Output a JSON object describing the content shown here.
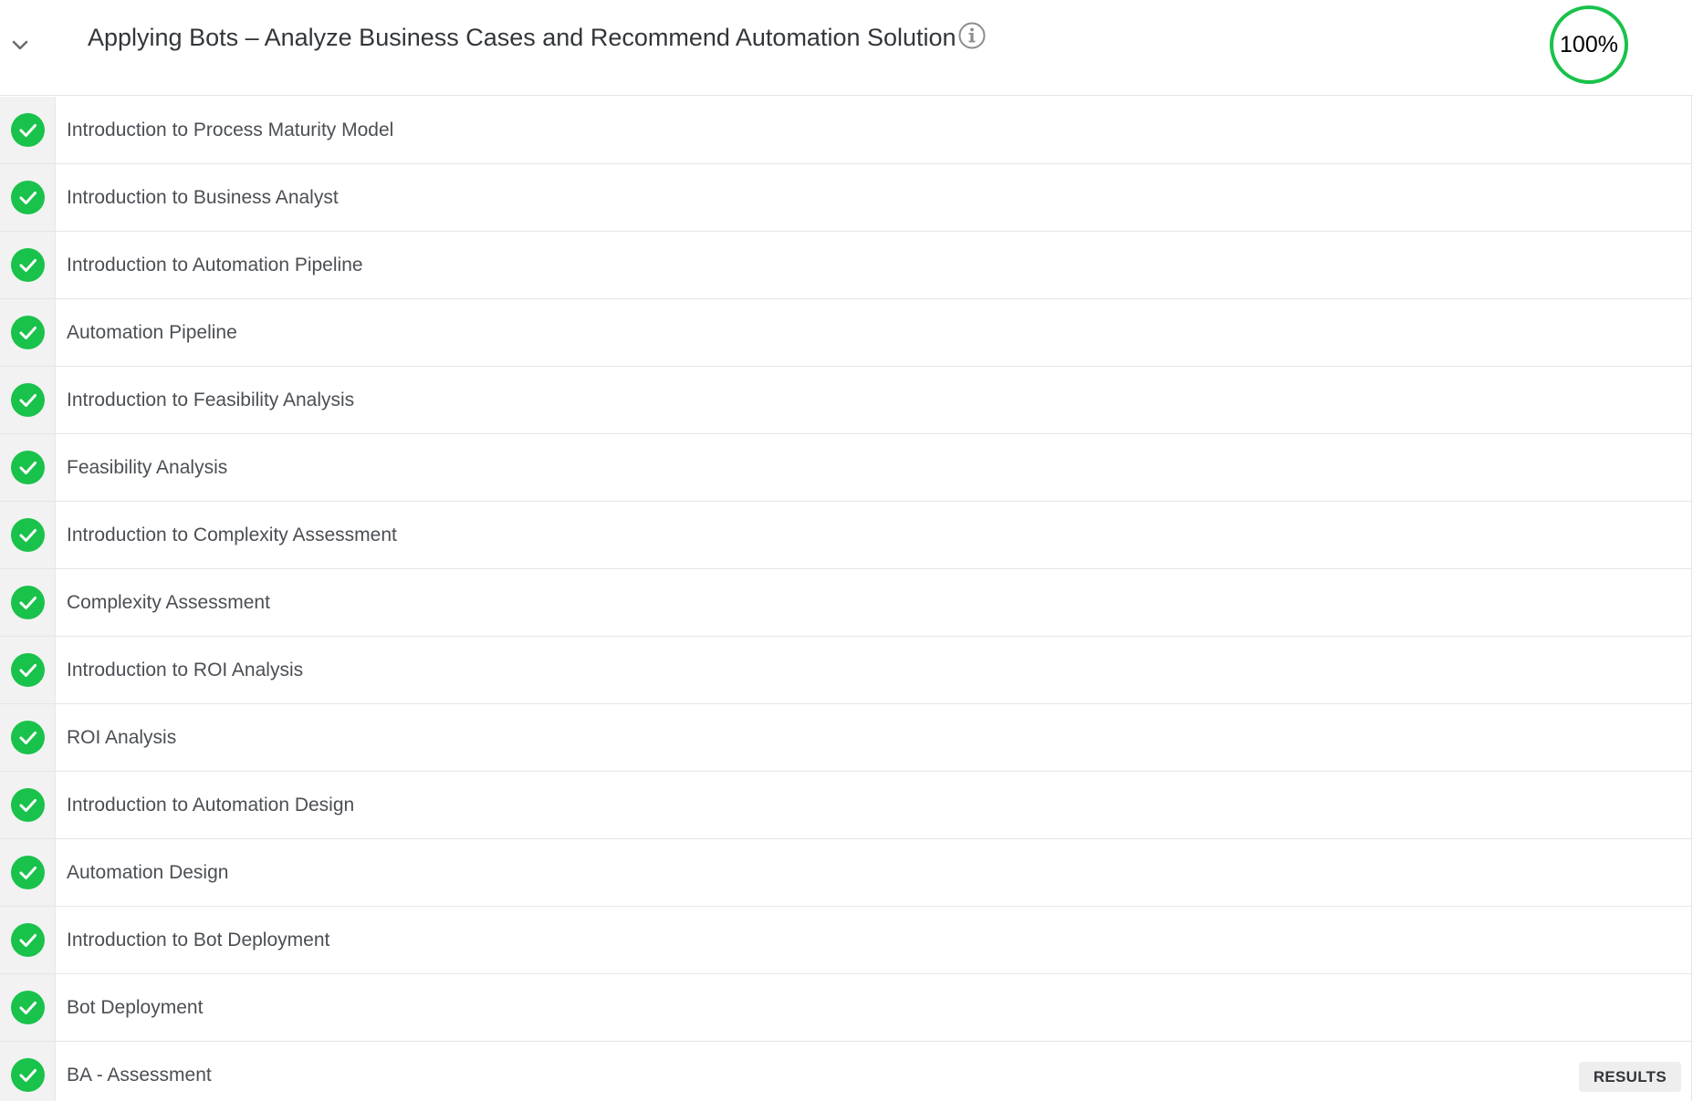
{
  "header": {
    "title": "Applying Bots – Analyze Business Cases and Recommend Automation Solution",
    "progress_label": "100%",
    "progress_fraction": 1.0
  },
  "colors": {
    "complete": "#19c24a",
    "text": "#32363a",
    "row_text": "#4b4f54"
  },
  "icons": {
    "collapse": "chevron-down-icon",
    "info": "info-icon",
    "status": "check-circle-icon"
  },
  "items": [
    {
      "label": "Introduction to Process Maturity Model",
      "status": "complete"
    },
    {
      "label": "Introduction to Business Analyst",
      "status": "complete"
    },
    {
      "label": "Introduction to Automation Pipeline",
      "status": "complete"
    },
    {
      "label": "Automation Pipeline",
      "status": "complete"
    },
    {
      "label": "Introduction to Feasibility Analysis",
      "status": "complete"
    },
    {
      "label": "Feasibility Analysis",
      "status": "complete"
    },
    {
      "label": "Introduction to Complexity Assessment",
      "status": "complete"
    },
    {
      "label": "Complexity Assessment",
      "status": "complete"
    },
    {
      "label": "Introduction to ROI Analysis",
      "status": "complete"
    },
    {
      "label": "ROI Analysis",
      "status": "complete"
    },
    {
      "label": "Introduction to Automation Design",
      "status": "complete"
    },
    {
      "label": "Automation Design",
      "status": "complete"
    },
    {
      "label": "Introduction to Bot Deployment",
      "status": "complete"
    },
    {
      "label": "Bot Deployment",
      "status": "complete"
    },
    {
      "label": "BA - Assessment",
      "status": "complete",
      "action_label": "RESULTS"
    }
  ]
}
